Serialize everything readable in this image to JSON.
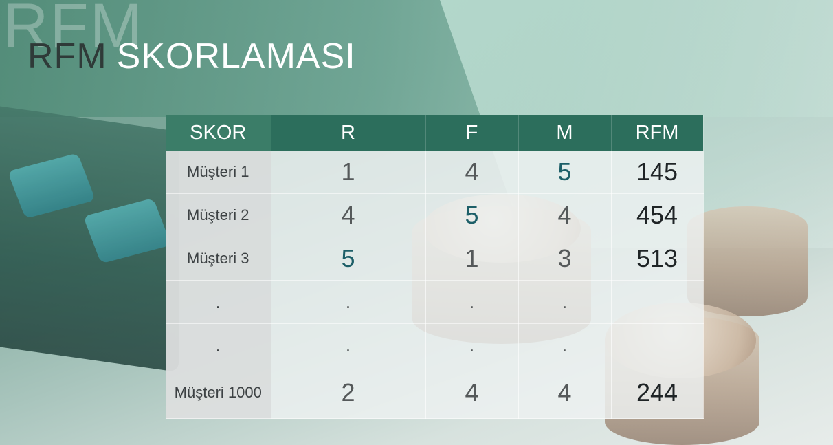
{
  "background": {
    "watermark": "RFM"
  },
  "title": {
    "part_a": "RFM",
    "part_b": "SKORLAMASI"
  },
  "table": {
    "headers": [
      "SKOR",
      "R",
      "F",
      "M",
      "RFM"
    ],
    "rows": [
      {
        "label": "Müşteri 1",
        "r": "1",
        "f": "4",
        "m": "5",
        "rfm": "145",
        "highlight": "m"
      },
      {
        "label": "Müşteri 2",
        "r": "4",
        "f": "5",
        "m": "4",
        "rfm": "454",
        "highlight": "f"
      },
      {
        "label": "Müşteri 3",
        "r": "5",
        "f": "1",
        "m": "3",
        "rfm": "513",
        "highlight": "r"
      },
      {
        "label": ".",
        "r": ".",
        "f": ".",
        "m": ".",
        "rfm": ""
      },
      {
        "label": ".",
        "r": ".",
        "f": ".",
        "m": ".",
        "rfm": ""
      },
      {
        "label": "Müşteri 1000",
        "r": "2",
        "f": "4",
        "m": "4",
        "rfm": "244"
      }
    ]
  },
  "colors": {
    "header_bg": "#2c6e5c",
    "highlight_value": "#1d5f68",
    "title_dark": "#2f3a38",
    "title_light": "#ffffff"
  }
}
